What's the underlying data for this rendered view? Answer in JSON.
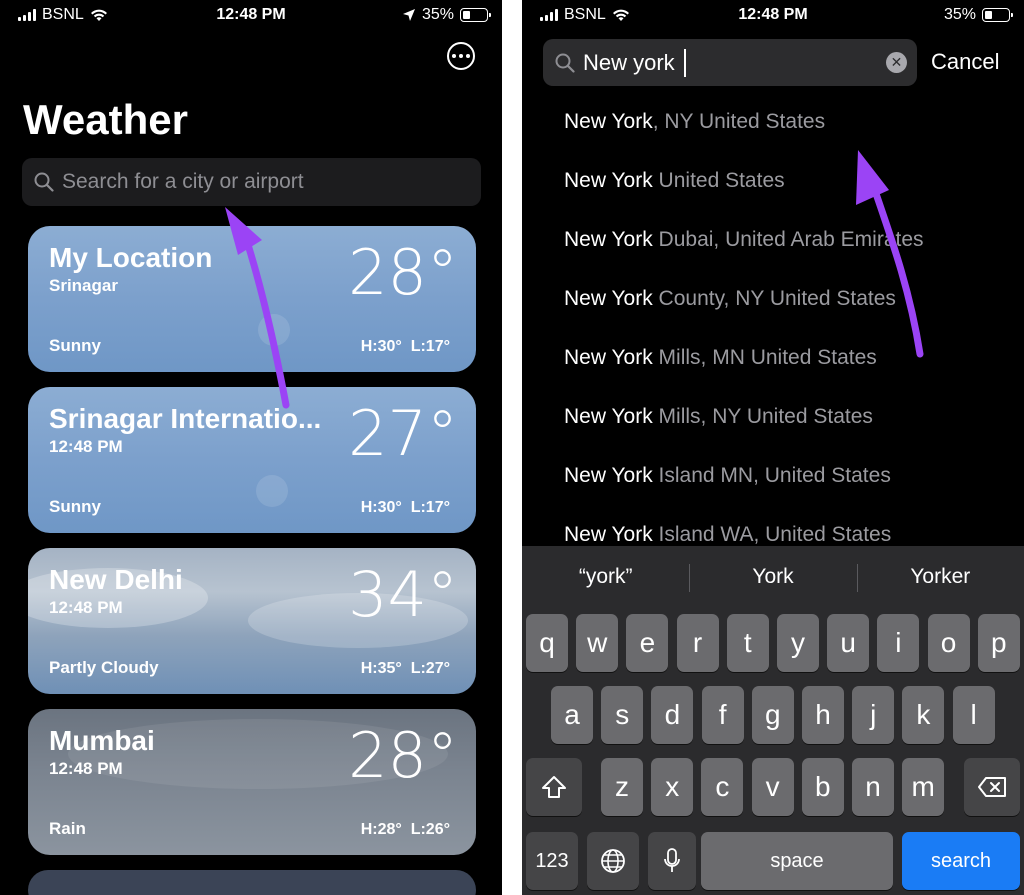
{
  "left": {
    "status": {
      "carrier": "BSNL",
      "time": "12:48 PM",
      "battery": "35%"
    },
    "title": "Weather",
    "search_placeholder": "Search for a city or airport",
    "cards": [
      {
        "name": "My Location",
        "sub": "Srinagar",
        "temp": "28°",
        "condition": "Sunny",
        "high": "H:30°",
        "low": "L:17°"
      },
      {
        "name": "Srinagar Internatio...",
        "sub": "12:48 PM",
        "temp": "27°",
        "condition": "Sunny",
        "high": "H:30°",
        "low": "L:17°"
      },
      {
        "name": "New Delhi",
        "sub": "12:48 PM",
        "temp": "34°",
        "condition": "Partly Cloudy",
        "high": "H:35°",
        "low": "L:27°"
      },
      {
        "name": "Mumbai",
        "sub": "12:48 PM",
        "temp": "28°",
        "condition": "Rain",
        "high": "H:28°",
        "low": "L:26°"
      }
    ]
  },
  "right": {
    "status": {
      "carrier": "BSNL",
      "time": "12:48 PM",
      "battery": "35%"
    },
    "search_value": "New york",
    "cancel": "Cancel",
    "results": [
      {
        "match": "New York",
        "rest": ", NY United States"
      },
      {
        "match": "New York",
        "rest": " United States"
      },
      {
        "match": "New York",
        "rest": " Dubai, United Arab Emirates"
      },
      {
        "match": "New York",
        "rest": " County, NY United States"
      },
      {
        "match": "New York",
        "rest": " Mills, MN United States"
      },
      {
        "match": "New York",
        "rest": " Mills, NY United States"
      },
      {
        "match": "New York",
        "rest": " Island MN, United States"
      },
      {
        "match": "New York",
        "rest": " Island WA, United States"
      }
    ],
    "keyboard": {
      "suggestions": [
        "“york”",
        "York",
        "Yorker"
      ],
      "row1": [
        "q",
        "w",
        "e",
        "r",
        "t",
        "y",
        "u",
        "i",
        "o",
        "p"
      ],
      "row2": [
        "a",
        "s",
        "d",
        "f",
        "g",
        "h",
        "j",
        "k",
        "l"
      ],
      "row3": [
        "z",
        "x",
        "c",
        "v",
        "b",
        "n",
        "m"
      ],
      "numbers": "123",
      "space": "space",
      "search": "search"
    }
  },
  "colors": {
    "arrow": "#9b44f5",
    "search_key": "#1a7cf5"
  }
}
